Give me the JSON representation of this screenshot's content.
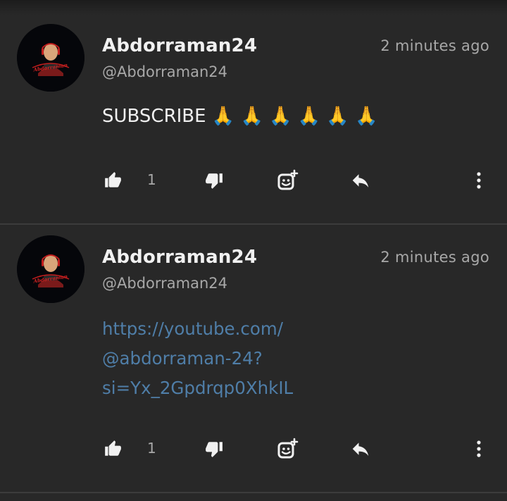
{
  "colors": {
    "background": "#282828",
    "primary_text": "#f1f1f1",
    "secondary_text": "#a8a8a8",
    "link": "#4f7ea8",
    "divider": "#3c3c3c"
  },
  "comments": [
    {
      "author": "Abdorraman24",
      "handle": "@Abdorraman24",
      "time": "2 minutes ago",
      "text": "SUBSCRIBE 🙏 🙏 🙏 🙏 🙏 🙏",
      "like_count": "1",
      "avatar_logo_text": "Abdorraman",
      "actions": [
        "thumbs-up-icon",
        "thumbs-down-icon",
        "add-emoji-reaction-icon",
        "reply-icon",
        "more-vert-icon"
      ]
    },
    {
      "author": "Abdorraman24",
      "handle": "@Abdorraman24",
      "time": "2 minutes ago",
      "link_lines": [
        "https://youtube.com/",
        "@abdorraman-24?",
        "si=Yx_2Gpdrqp0XhkIL"
      ],
      "like_count": "1",
      "avatar_logo_text": "Abdorraman",
      "actions": [
        "thumbs-up-icon",
        "thumbs-down-icon",
        "add-emoji-reaction-icon",
        "reply-icon",
        "more-vert-icon"
      ]
    }
  ]
}
